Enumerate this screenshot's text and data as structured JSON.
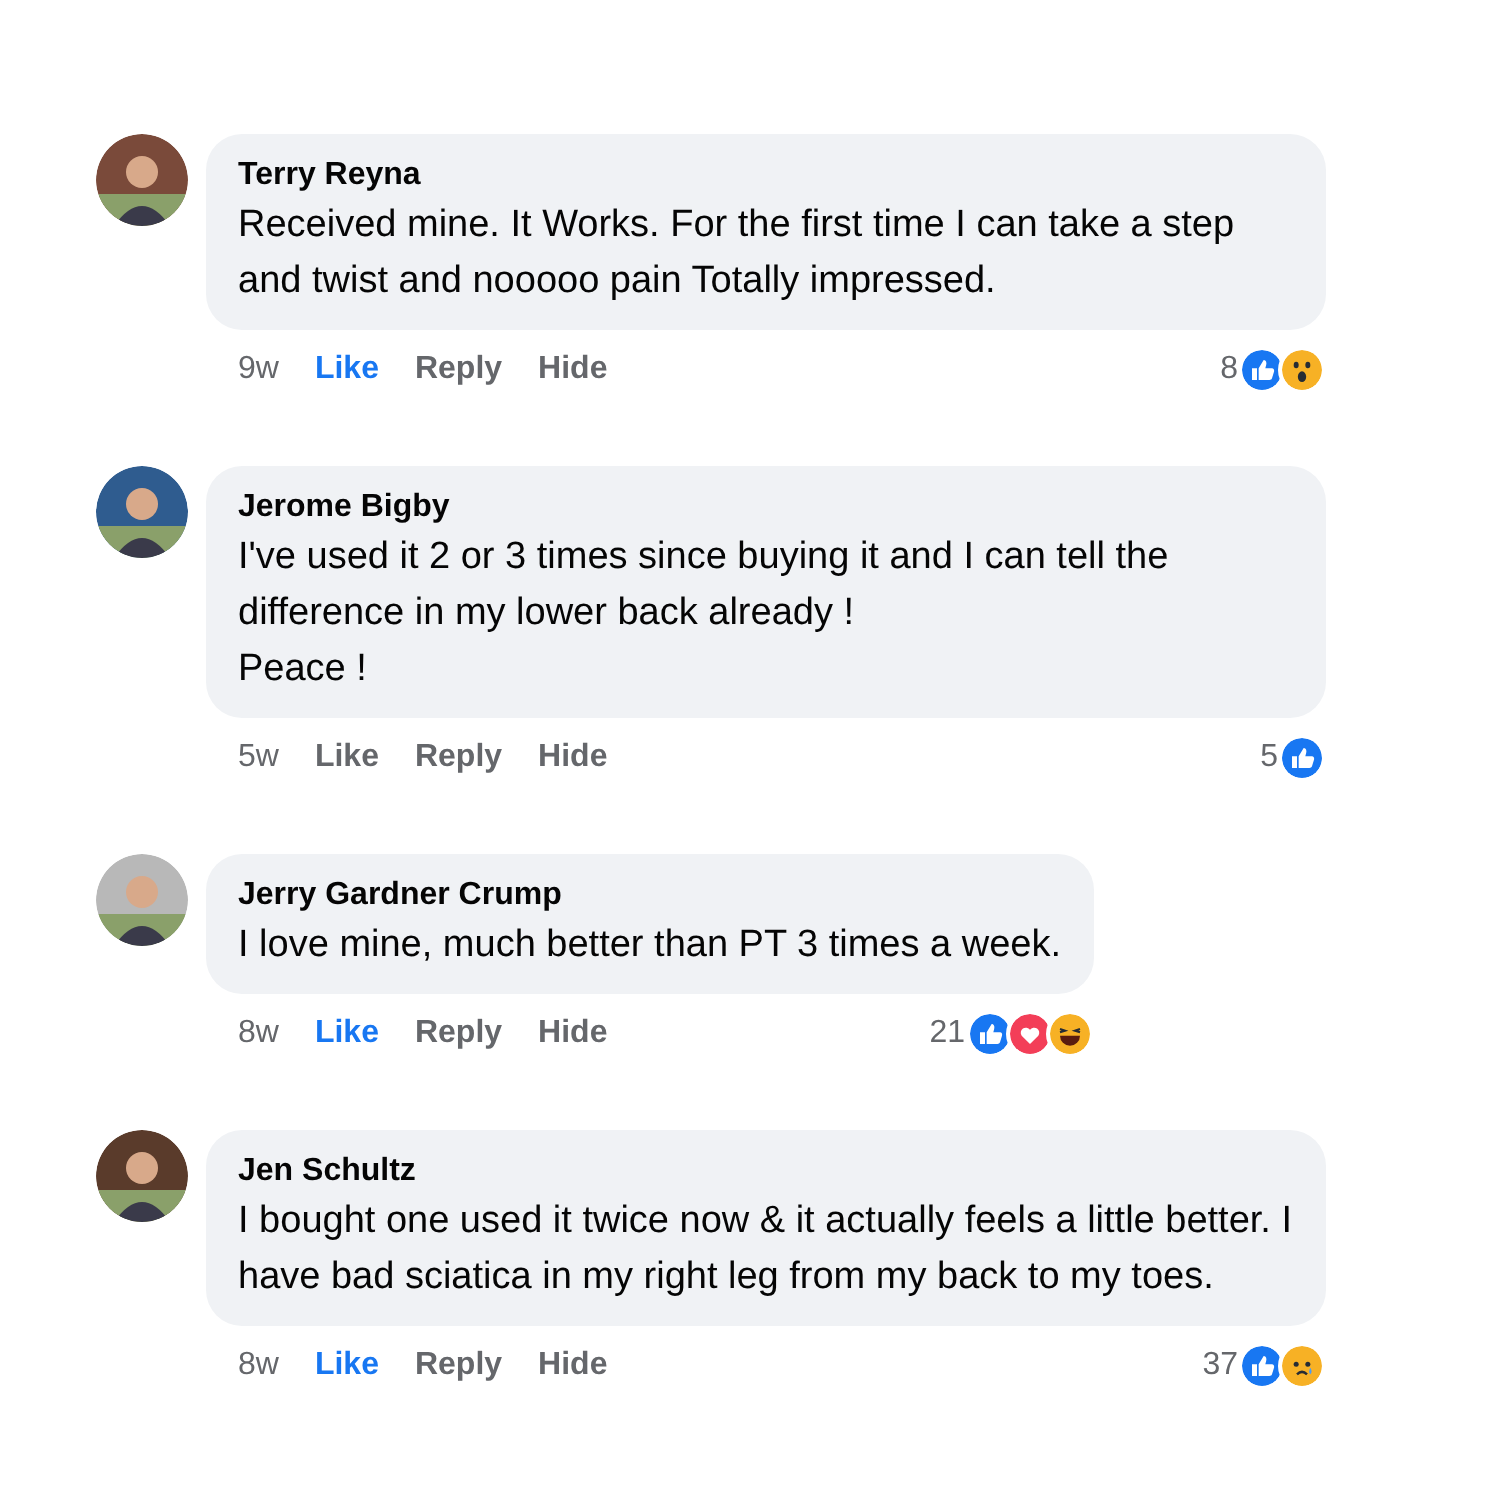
{
  "comments": [
    {
      "author": "Terry Reyna",
      "text": "Received mine. It Works. For the first time I can take a step and twist and nooooo pain Totally impressed.",
      "time": "9w",
      "actions": [
        {
          "label": "Like",
          "selected": true
        },
        {
          "label": "Reply",
          "selected": false
        },
        {
          "label": "Hide",
          "selected": false
        }
      ],
      "reaction_count": "8",
      "reactions": [
        {
          "kind": "like"
        },
        {
          "kind": "wow"
        }
      ]
    },
    {
      "author": "Jerome Bigby",
      "text": "I've used it 2 or 3 times since buying it and I can tell the difference in my lower back already !\nPeace !",
      "time": "5w",
      "actions": [
        {
          "label": "Like",
          "selected": false
        },
        {
          "label": "Reply",
          "selected": false
        },
        {
          "label": "Hide",
          "selected": false
        }
      ],
      "reaction_count": "5",
      "reactions": [
        {
          "kind": "like"
        }
      ]
    },
    {
      "author": "Jerry Gardner Crump",
      "text": "I love mine, much better than PT 3 times a week.",
      "time": "8w",
      "actions": [
        {
          "label": "Like",
          "selected": true
        },
        {
          "label": "Reply",
          "selected": false
        },
        {
          "label": "Hide",
          "selected": false
        }
      ],
      "reaction_count": "21",
      "reactions": [
        {
          "kind": "like"
        },
        {
          "kind": "love"
        },
        {
          "kind": "haha"
        }
      ]
    },
    {
      "author": "Jen Schultz",
      "text": "I bought one used it twice now & it actually feels a little better. I have bad sciatica in my right leg from my back to my toes.",
      "time": "8w",
      "actions": [
        {
          "label": "Like",
          "selected": true
        },
        {
          "label": "Reply",
          "selected": false
        },
        {
          "label": "Hide",
          "selected": false
        }
      ],
      "reaction_count": "37",
      "reactions": [
        {
          "kind": "like"
        },
        {
          "kind": "sad"
        }
      ]
    }
  ]
}
